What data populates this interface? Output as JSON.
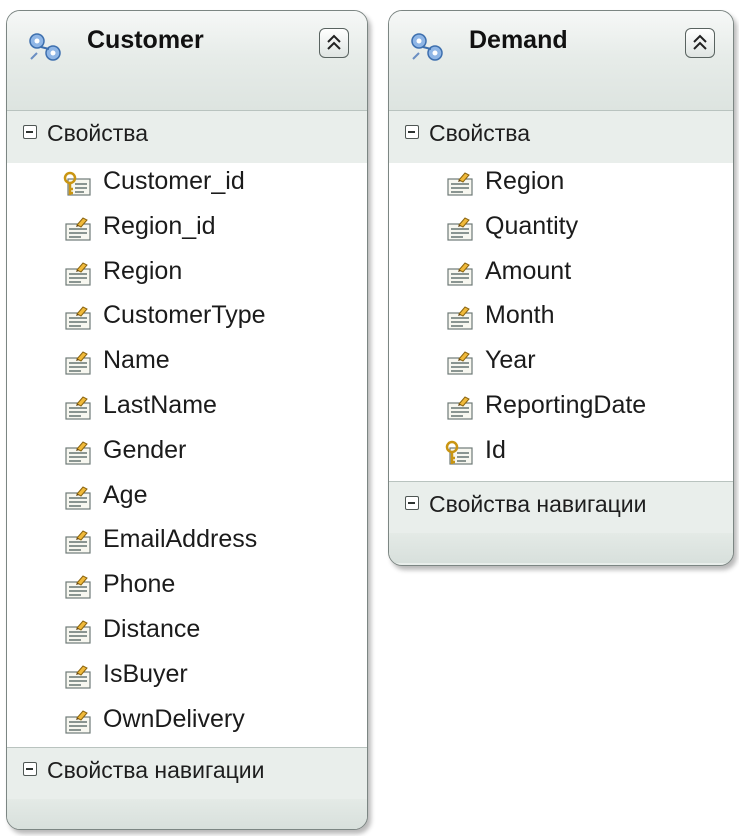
{
  "entities": {
    "customer": {
      "title": "Customer",
      "properties_label": "Свойства",
      "navigation_label": "Свойства навигации",
      "properties": [
        {
          "name": "Customer_id",
          "key": true
        },
        {
          "name": "Region_id",
          "key": false
        },
        {
          "name": "Region",
          "key": false
        },
        {
          "name": "CustomerType",
          "key": false
        },
        {
          "name": "Name",
          "key": false
        },
        {
          "name": "LastName",
          "key": false
        },
        {
          "name": "Gender",
          "key": false
        },
        {
          "name": "Age",
          "key": false
        },
        {
          "name": "EmailAddress",
          "key": false
        },
        {
          "name": "Phone",
          "key": false
        },
        {
          "name": "Distance",
          "key": false
        },
        {
          "name": "IsBuyer",
          "key": false
        },
        {
          "name": "OwnDelivery",
          "key": false
        }
      ]
    },
    "demand": {
      "title": "Demand",
      "properties_label": "Свойства",
      "navigation_label": "Свойства навигации",
      "properties": [
        {
          "name": "Region",
          "key": false
        },
        {
          "name": "Quantity",
          "key": false
        },
        {
          "name": "Amount",
          "key": false
        },
        {
          "name": "Month",
          "key": false
        },
        {
          "name": "Year",
          "key": false
        },
        {
          "name": "ReportingDate",
          "key": false
        },
        {
          "name": "Id",
          "key": true
        }
      ]
    }
  },
  "icons": {
    "entity": "entity-icon",
    "property": "property-icon",
    "key_property": "key-property-icon",
    "collapse": "collapse-up-icon",
    "section_toggle": "minus-box-icon"
  }
}
